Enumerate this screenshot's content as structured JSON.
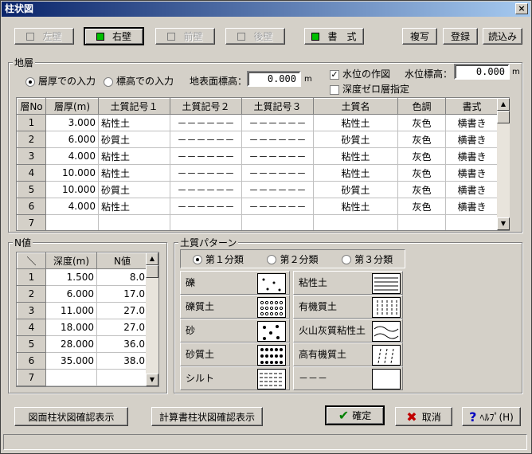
{
  "window": {
    "title": "柱状図",
    "close": "×"
  },
  "topbar": {
    "buttons": [
      {
        "label": "左壁",
        "led": "off",
        "state": "disabled"
      },
      {
        "label": "右壁",
        "led": "on",
        "state": "selected"
      },
      {
        "label": "前壁",
        "led": "off",
        "state": "disabled"
      },
      {
        "label": "後壁",
        "led": "off",
        "state": "disabled"
      },
      {
        "label": "書　式",
        "led": "on",
        "state": "normal"
      }
    ],
    "copy": "複写",
    "register": "登録",
    "load": "読込み"
  },
  "layer": {
    "group": "地層",
    "radio_thickness": "層厚での入力",
    "radio_elevation": "標高での入力",
    "ground_label": "地表面標高：",
    "ground_value": "0.000",
    "ground_unit": "m",
    "water_check": "水位の作図",
    "water_checked": true,
    "water_label": "水位標高：",
    "water_value": "0.000",
    "water_unit": "m",
    "depth_zero_check": "深度ゼロ層指定",
    "columns": [
      "層No",
      "層厚(m)",
      "土質記号１",
      "土質記号２",
      "土質記号３",
      "土質名",
      "色調",
      "書式"
    ],
    "rows": [
      [
        "1",
        "3.000",
        "粘性土",
        "－－－－－－",
        "－－－－－－",
        "粘性土",
        "灰色",
        "横書き"
      ],
      [
        "2",
        "6.000",
        "砂質土",
        "－－－－－－",
        "－－－－－－",
        "砂質土",
        "灰色",
        "横書き"
      ],
      [
        "3",
        "4.000",
        "粘性土",
        "－－－－－－",
        "－－－－－－",
        "粘性土",
        "灰色",
        "横書き"
      ],
      [
        "4",
        "10.000",
        "粘性土",
        "－－－－－－",
        "－－－－－－",
        "粘性土",
        "灰色",
        "横書き"
      ],
      [
        "5",
        "10.000",
        "砂質土",
        "－－－－－－",
        "－－－－－－",
        "砂質土",
        "灰色",
        "横書き"
      ],
      [
        "6",
        "4.000",
        "粘性土",
        "－－－－－－",
        "－－－－－－",
        "粘性土",
        "灰色",
        "横書き"
      ],
      [
        "7",
        "",
        "",
        "",
        "",
        "",
        "",
        ""
      ]
    ]
  },
  "nvalue": {
    "group": "N値",
    "columns": [
      "＼",
      "深度(m)",
      "N値"
    ],
    "rows": [
      [
        "1",
        "1.500",
        "8.0"
      ],
      [
        "2",
        "6.000",
        "17.0"
      ],
      [
        "3",
        "11.000",
        "27.0"
      ],
      [
        "4",
        "18.000",
        "27.0"
      ],
      [
        "5",
        "28.000",
        "36.0"
      ],
      [
        "6",
        "35.000",
        "38.0"
      ],
      [
        "7",
        "",
        ""
      ]
    ]
  },
  "pattern": {
    "group": "土質パターン",
    "radios": [
      "第１分類",
      "第２分類",
      "第３分類"
    ],
    "left": [
      "礫",
      "礫質土",
      "砂",
      "砂質土",
      "シルト"
    ],
    "right": [
      "粘性土",
      "有機質土",
      "火山灰質粘性土",
      "高有機質土",
      "－－－"
    ]
  },
  "footer": {
    "drawing_confirm": "図面柱状図確認表示",
    "calc_confirm": "計算書柱状図確認表示",
    "ok": "確定",
    "cancel": "取消",
    "help": "ﾍﾙﾌﾟ(H)"
  }
}
